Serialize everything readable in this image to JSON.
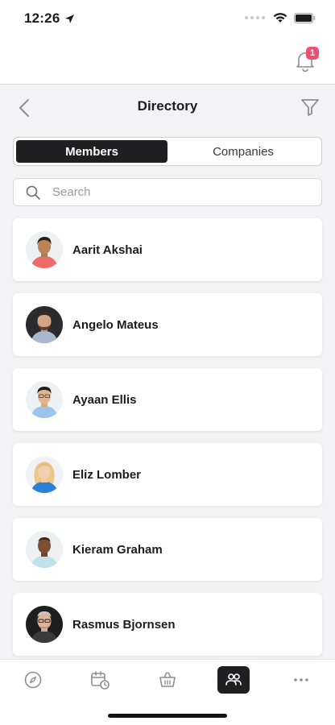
{
  "status_bar": {
    "time": "12:26"
  },
  "notifications": {
    "badge_count": "1"
  },
  "header": {
    "title": "Directory"
  },
  "segments": [
    {
      "label": "Members",
      "active": true
    },
    {
      "label": "Companies",
      "active": false
    }
  ],
  "search": {
    "placeholder": "Search",
    "value": ""
  },
  "members": [
    {
      "name": "Aarit Akshai",
      "avatar": "avatar-photo"
    },
    {
      "name": "Angelo Mateus",
      "avatar": "avatar-photo"
    },
    {
      "name": "Ayaan Ellis",
      "avatar": "avatar-photo"
    },
    {
      "name": "Eliz Lomber",
      "avatar": "avatar-photo"
    },
    {
      "name": "Kieram Graham",
      "avatar": "avatar-photo"
    },
    {
      "name": "Rasmus Bjornsen",
      "avatar": "avatar-photo"
    }
  ],
  "tab_bar": {
    "items": [
      {
        "icon": "compass-icon",
        "active": false
      },
      {
        "icon": "calendar-clock-icon",
        "active": false
      },
      {
        "icon": "basket-icon",
        "active": false
      },
      {
        "icon": "members-icon",
        "active": true
      },
      {
        "icon": "more-icon",
        "active": false
      }
    ]
  },
  "colors": {
    "accent_dark": "#1f1f21",
    "badge": "#ef4f6b",
    "background": "#f3f3f5"
  }
}
